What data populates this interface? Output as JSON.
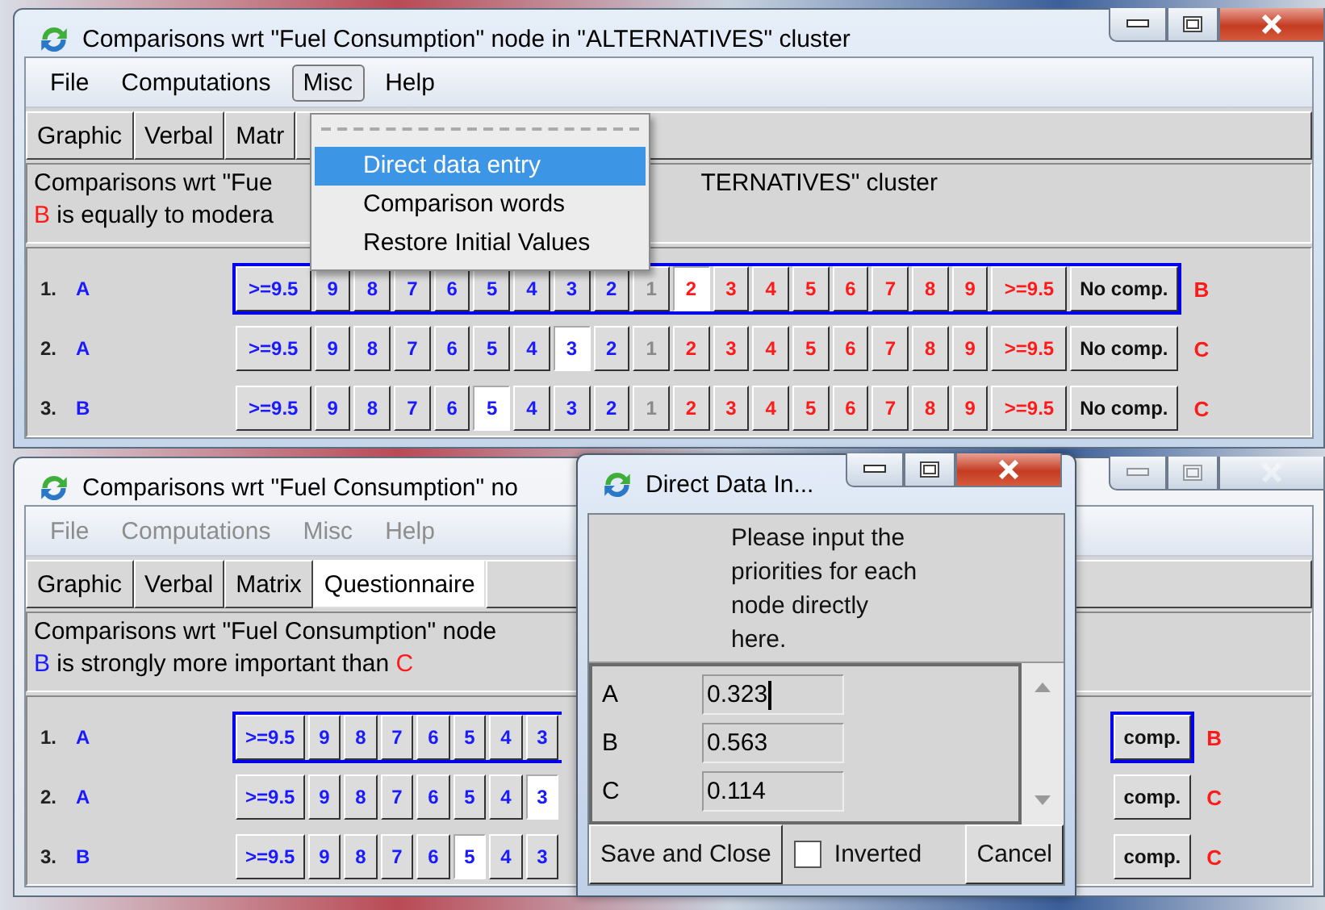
{
  "windows": [
    {
      "title": "Comparisons wrt \"Fuel Consumption\" node in \"ALTERNATIVES\" cluster",
      "active": true,
      "menu": [
        {
          "label": "File",
          "selected": false,
          "disabled": false
        },
        {
          "label": "Computations",
          "selected": false,
          "disabled": false
        },
        {
          "label": "Misc",
          "selected": true,
          "disabled": false
        },
        {
          "label": "Help",
          "selected": false,
          "disabled": false
        }
      ],
      "tabs": [
        {
          "label": "Graphic",
          "selected": false
        },
        {
          "label": "Verbal",
          "selected": false
        },
        {
          "label": "Matr",
          "selected": false
        }
      ],
      "info": {
        "line_1": [
          "Comparisons wrt \"Fue",
          "TERNATIVES\" cluster"
        ],
        "line_2": [
          {
            "kind": "right",
            "text": "B"
          },
          {
            "kind": "plain",
            "text": " is equally to modera"
          }
        ]
      },
      "rows": [
        {
          "number": "1.",
          "left_node": "A",
          "right_node": "B",
          "focused": true,
          "left_buttons": [
            {
              "label": ">=9.5",
              "selected": false,
              "disabled": false
            },
            {
              "label": "9",
              "selected": false,
              "disabled": false
            },
            {
              "label": "8",
              "selected": false,
              "disabled": false
            },
            {
              "label": "7",
              "selected": false,
              "disabled": false
            },
            {
              "label": "6",
              "selected": false,
              "disabled": false
            },
            {
              "label": "5",
              "selected": false,
              "disabled": false
            },
            {
              "label": "4",
              "selected": false,
              "disabled": false
            },
            {
              "label": "3",
              "selected": false,
              "disabled": false
            },
            {
              "label": "2",
              "selected": false,
              "disabled": false
            },
            {
              "label": "1",
              "selected": false,
              "disabled": true
            }
          ],
          "right_buttons": [
            {
              "label": "2",
              "selected": true,
              "disabled": false
            },
            {
              "label": "3",
              "selected": false,
              "disabled": false
            },
            {
              "label": "4",
              "selected": false,
              "disabled": false
            },
            {
              "label": "5",
              "selected": false,
              "disabled": false
            },
            {
              "label": "6",
              "selected": false,
              "disabled": false
            },
            {
              "label": "7",
              "selected": false,
              "disabled": false
            },
            {
              "label": "8",
              "selected": false,
              "disabled": false
            },
            {
              "label": "9",
              "selected": false,
              "disabled": false
            },
            {
              "label": ">=9.5",
              "selected": false,
              "disabled": false
            }
          ],
          "no_comp": "No comp."
        },
        {
          "number": "2.",
          "left_node": "A",
          "right_node": "C",
          "focused": false,
          "left_buttons": [
            {
              "label": ">=9.5",
              "selected": false,
              "disabled": false
            },
            {
              "label": "9",
              "selected": false,
              "disabled": false
            },
            {
              "label": "8",
              "selected": false,
              "disabled": false
            },
            {
              "label": "7",
              "selected": false,
              "disabled": false
            },
            {
              "label": "6",
              "selected": false,
              "disabled": false
            },
            {
              "label": "5",
              "selected": false,
              "disabled": false
            },
            {
              "label": "4",
              "selected": false,
              "disabled": false
            },
            {
              "label": "3",
              "selected": true,
              "disabled": false
            },
            {
              "label": "2",
              "selected": false,
              "disabled": false
            },
            {
              "label": "1",
              "selected": false,
              "disabled": true
            }
          ],
          "right_buttons": [
            {
              "label": "2",
              "selected": false,
              "disabled": false
            },
            {
              "label": "3",
              "selected": false,
              "disabled": false
            },
            {
              "label": "4",
              "selected": false,
              "disabled": false
            },
            {
              "label": "5",
              "selected": false,
              "disabled": false
            },
            {
              "label": "6",
              "selected": false,
              "disabled": false
            },
            {
              "label": "7",
              "selected": false,
              "disabled": false
            },
            {
              "label": "8",
              "selected": false,
              "disabled": false
            },
            {
              "label": "9",
              "selected": false,
              "disabled": false
            },
            {
              "label": ">=9.5",
              "selected": false,
              "disabled": false
            }
          ],
          "no_comp": "No comp."
        },
        {
          "number": "3.",
          "left_node": "B",
          "right_node": "C",
          "focused": false,
          "left_buttons": [
            {
              "label": ">=9.5",
              "selected": false,
              "disabled": false
            },
            {
              "label": "9",
              "selected": false,
              "disabled": false
            },
            {
              "label": "8",
              "selected": false,
              "disabled": false
            },
            {
              "label": "7",
              "selected": false,
              "disabled": false
            },
            {
              "label": "6",
              "selected": false,
              "disabled": false
            },
            {
              "label": "5",
              "selected": true,
              "disabled": false
            },
            {
              "label": "4",
              "selected": false,
              "disabled": false
            },
            {
              "label": "3",
              "selected": false,
              "disabled": false
            },
            {
              "label": "2",
              "selected": false,
              "disabled": false
            },
            {
              "label": "1",
              "selected": false,
              "disabled": true
            }
          ],
          "right_buttons": [
            {
              "label": "2",
              "selected": false,
              "disabled": false
            },
            {
              "label": "3",
              "selected": false,
              "disabled": false
            },
            {
              "label": "4",
              "selected": false,
              "disabled": false
            },
            {
              "label": "5",
              "selected": false,
              "disabled": false
            },
            {
              "label": "6",
              "selected": false,
              "disabled": false
            },
            {
              "label": "7",
              "selected": false,
              "disabled": false
            },
            {
              "label": "8",
              "selected": false,
              "disabled": false
            },
            {
              "label": "9",
              "selected": false,
              "disabled": false
            },
            {
              "label": ">=9.5",
              "selected": false,
              "disabled": false
            }
          ],
          "no_comp": "No comp."
        }
      ]
    },
    {
      "title": "Comparisons wrt \"Fuel Consumption\" no",
      "active": false,
      "menu": [
        {
          "label": "File",
          "selected": false,
          "disabled": true
        },
        {
          "label": "Computations",
          "selected": false,
          "disabled": true
        },
        {
          "label": "Misc",
          "selected": false,
          "disabled": true
        },
        {
          "label": "Help",
          "selected": false,
          "disabled": true
        }
      ],
      "tabs": [
        {
          "label": "Graphic",
          "selected": false
        },
        {
          "label": "Verbal",
          "selected": false
        },
        {
          "label": "Matrix",
          "selected": false
        },
        {
          "label": "Questionnaire",
          "selected": true
        }
      ],
      "info": {
        "line_1": [
          "Comparisons wrt \"Fuel Consumption\" node"
        ],
        "line_2": [
          {
            "kind": "left",
            "text": "B"
          },
          {
            "kind": "plain",
            "text": " is strongly more important than "
          },
          {
            "kind": "right",
            "text": "C"
          }
        ]
      },
      "rows": [
        {
          "number": "1.",
          "left_node": "A",
          "right_node": "B",
          "focused": true,
          "left_buttons": [
            {
              "label": ">=9.5",
              "selected": false,
              "disabled": false
            },
            {
              "label": "9",
              "selected": false,
              "disabled": false
            },
            {
              "label": "8",
              "selected": false,
              "disabled": false
            },
            {
              "label": "7",
              "selected": false,
              "disabled": false
            },
            {
              "label": "6",
              "selected": false,
              "disabled": false
            },
            {
              "label": "5",
              "selected": false,
              "disabled": false
            },
            {
              "label": "4",
              "selected": false,
              "disabled": false
            },
            {
              "label": "3",
              "selected": false,
              "disabled": false
            }
          ],
          "no_comp": "comp."
        },
        {
          "number": "2.",
          "left_node": "A",
          "right_node": "C",
          "focused": false,
          "left_buttons": [
            {
              "label": ">=9.5",
              "selected": false,
              "disabled": false
            },
            {
              "label": "9",
              "selected": false,
              "disabled": false
            },
            {
              "label": "8",
              "selected": false,
              "disabled": false
            },
            {
              "label": "7",
              "selected": false,
              "disabled": false
            },
            {
              "label": "6",
              "selected": false,
              "disabled": false
            },
            {
              "label": "5",
              "selected": false,
              "disabled": false
            },
            {
              "label": "4",
              "selected": false,
              "disabled": false
            },
            {
              "label": "3",
              "selected": true,
              "disabled": false
            }
          ],
          "no_comp": "comp."
        },
        {
          "number": "3.",
          "left_node": "B",
          "right_node": "C",
          "focused": false,
          "left_buttons": [
            {
              "label": ">=9.5",
              "selected": false,
              "disabled": false
            },
            {
              "label": "9",
              "selected": false,
              "disabled": false
            },
            {
              "label": "8",
              "selected": false,
              "disabled": false
            },
            {
              "label": "7",
              "selected": false,
              "disabled": false
            },
            {
              "label": "6",
              "selected": false,
              "disabled": false
            },
            {
              "label": "5",
              "selected": true,
              "disabled": false
            },
            {
              "label": "4",
              "selected": false,
              "disabled": false
            },
            {
              "label": "3",
              "selected": false,
              "disabled": false
            }
          ],
          "no_comp": "comp."
        }
      ]
    }
  ],
  "misc_menu": {
    "items": [
      {
        "label": "Direct data entry",
        "selected": true
      },
      {
        "label": "Comparison words",
        "selected": false
      },
      {
        "label": "Restore Initial Values",
        "selected": false
      }
    ]
  },
  "dialog": {
    "title": "Direct Data In...",
    "message": "Please input the priorities for each node directly here.",
    "entries": [
      {
        "name": "A",
        "value": "0.323",
        "focused": true
      },
      {
        "name": "B",
        "value": "0.563",
        "focused": false
      },
      {
        "name": "C",
        "value": "0.114",
        "focused": false
      }
    ],
    "save_button": "Save and Close",
    "checkbox": {
      "label": "Inverted",
      "checked": false
    },
    "cancel_button": "Cancel"
  }
}
